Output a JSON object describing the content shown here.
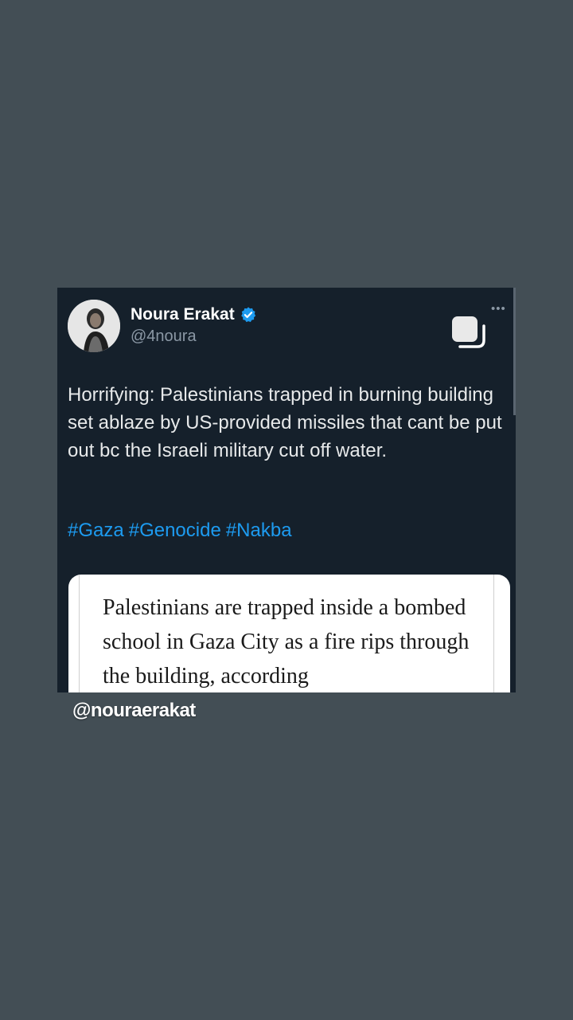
{
  "tweet": {
    "author_name": "Noura Erakat",
    "handle": "@4noura",
    "more_icon": "more-dots-icon",
    "text": "Horrifying: Palestinians trapped in burning building set ablaze by US-provided missiles that cant be put out bc the Israeli military cut off water.",
    "hashtags": [
      "#Gaza",
      "#Genocide",
      "#Nakba"
    ],
    "verified_color": "#1d9bf0",
    "hashtag_color": "#1d9bf0"
  },
  "card": {
    "text": "Palestinians are trapped inside a bombed school in Gaza City as a fire rips through the building, according"
  },
  "overlay": {
    "watermark": "@nouraerakat"
  }
}
